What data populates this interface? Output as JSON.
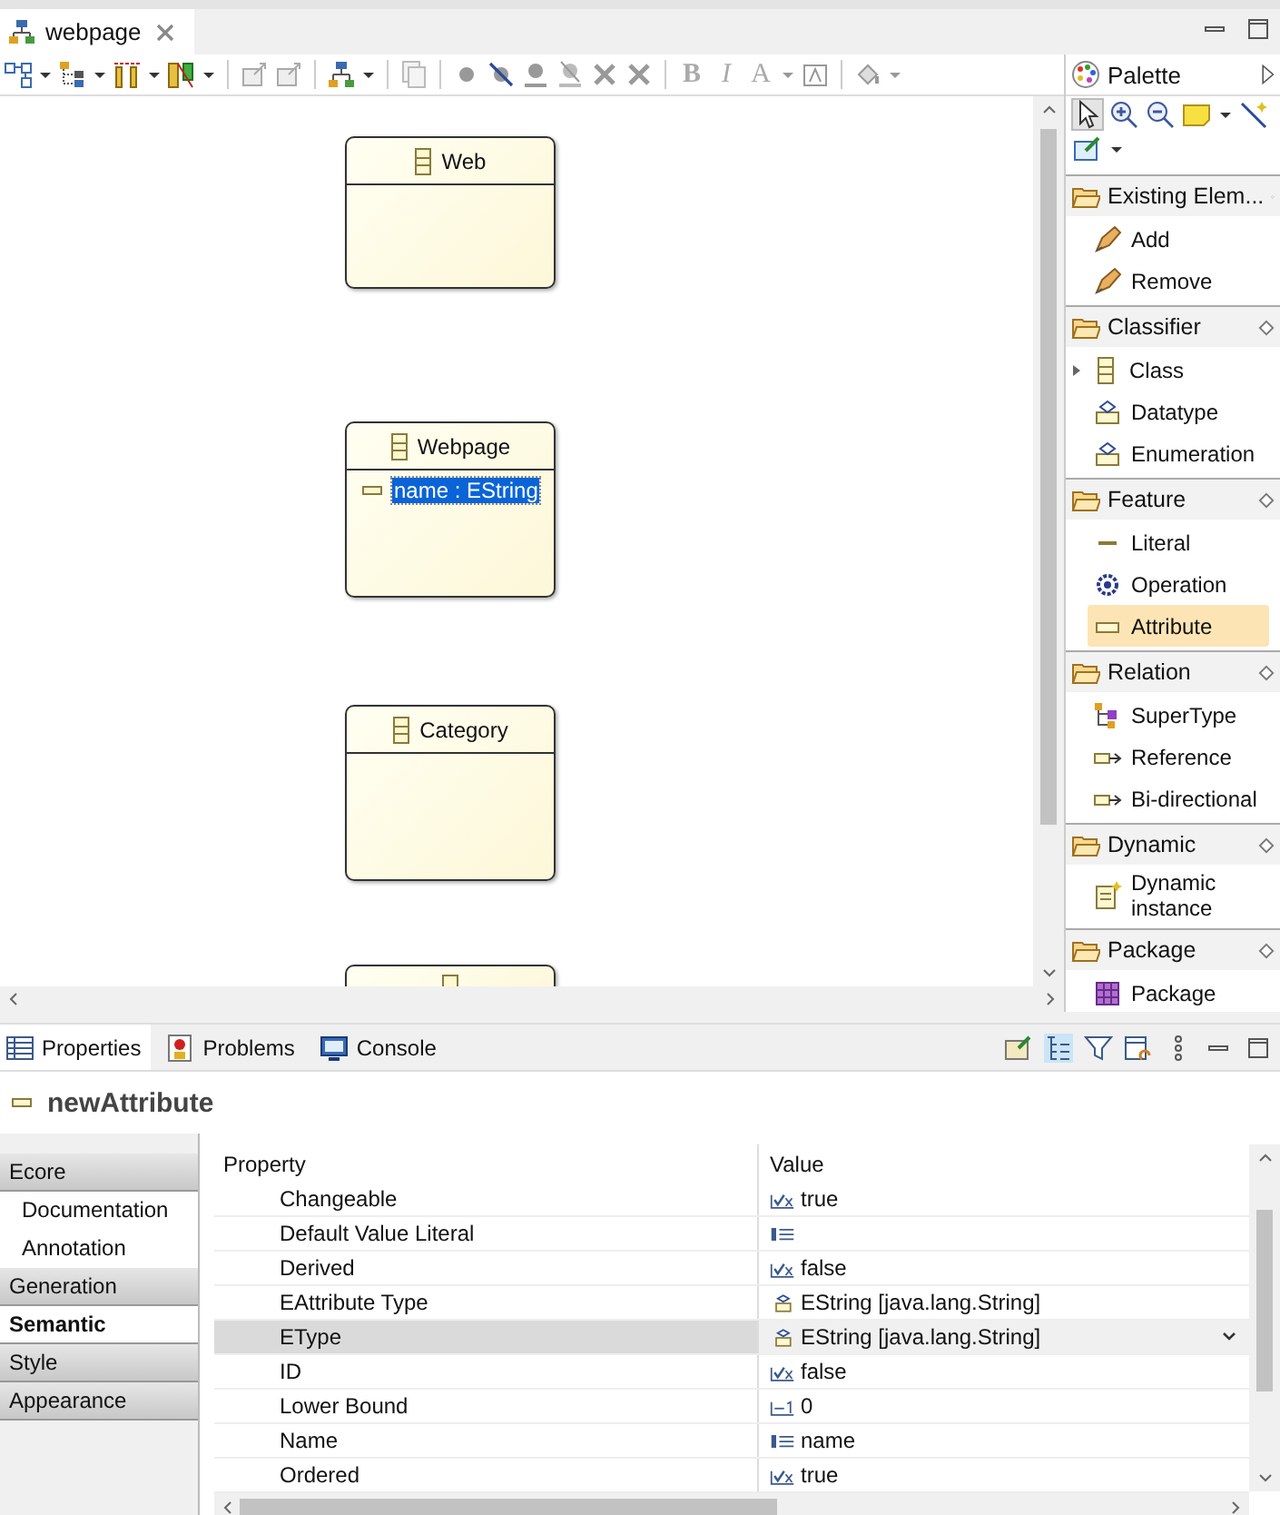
{
  "editor_tab": {
    "title": "webpage"
  },
  "toolbar": {
    "format_buttons": [
      {
        "label": "B",
        "kind": "bold"
      },
      {
        "label": "I",
        "kind": "italic"
      },
      {
        "label": "A",
        "kind": "font"
      }
    ]
  },
  "diagram": {
    "classes": [
      {
        "name": "Web"
      },
      {
        "name": "Webpage",
        "attributes": [
          {
            "label": "name : EString",
            "selected": true
          }
        ]
      },
      {
        "name": "Category"
      }
    ]
  },
  "palette": {
    "title": "Palette",
    "sections": [
      {
        "title": "Existing Elem...",
        "items": [
          {
            "label": "Add",
            "kind": "add",
            "selected": false
          },
          {
            "label": "Remove",
            "kind": "remove",
            "selected": false
          }
        ]
      },
      {
        "title": "Classifier",
        "items": [
          {
            "label": "Class",
            "kind": "class",
            "selected": false
          },
          {
            "label": "Datatype",
            "kind": "datatype",
            "selected": false
          },
          {
            "label": "Enumeration",
            "kind": "enumeration",
            "selected": false
          }
        ]
      },
      {
        "title": "Feature",
        "items": [
          {
            "label": "Literal",
            "kind": "literal",
            "selected": false
          },
          {
            "label": "Operation",
            "kind": "operation",
            "selected": false
          },
          {
            "label": "Attribute",
            "kind": "attribute",
            "selected": true
          }
        ]
      },
      {
        "title": "Relation",
        "items": [
          {
            "label": "SuperType",
            "kind": "supertype",
            "selected": false
          },
          {
            "label": "Reference",
            "kind": "reference",
            "selected": false
          },
          {
            "label": "Bi-directional",
            "kind": "reference",
            "selected": false
          }
        ]
      },
      {
        "title": "Dynamic",
        "items": [
          {
            "label": "Dynamic instance",
            "kind": "dynamic",
            "selected": false
          }
        ]
      },
      {
        "title": "Package",
        "items": [
          {
            "label": "Package",
            "kind": "package",
            "selected": false
          }
        ]
      }
    ]
  },
  "views": {
    "tabs": [
      {
        "label": "Properties",
        "kind": "properties",
        "selected": true
      },
      {
        "label": "Problems",
        "kind": "problems",
        "selected": false
      },
      {
        "label": "Console",
        "kind": "console",
        "selected": false
      }
    ]
  },
  "properties": {
    "title": "newAttribute",
    "categories": [
      {
        "label": "Ecore",
        "kind": "group",
        "selected": false
      },
      {
        "label": "Documentation",
        "kind": "sub",
        "selected": false
      },
      {
        "label": "Annotation",
        "kind": "sub",
        "selected": false
      },
      {
        "label": "Generation",
        "kind": "group",
        "selected": false
      },
      {
        "label": "Semantic",
        "kind": "group",
        "selected": true
      },
      {
        "label": "Style",
        "kind": "group",
        "selected": false
      },
      {
        "label": "Appearance",
        "kind": "group",
        "selected": false
      }
    ],
    "columns": [
      "Property",
      "Value"
    ],
    "rows": [
      {
        "property": "Changeable",
        "value": "true",
        "kind": "boolean",
        "selected": false
      },
      {
        "property": "Default Value Literal",
        "kind": "text",
        "selected": false
      },
      {
        "property": "Derived",
        "value": "false",
        "kind": "boolean",
        "selected": false
      },
      {
        "property": "EAttribute Type",
        "value": "EString [java.lang.String]",
        "kind": "type",
        "selected": false
      },
      {
        "property": "EType",
        "value": "EString [java.lang.String]",
        "kind": "type",
        "selected": true
      },
      {
        "property": "ID",
        "value": "false",
        "kind": "boolean",
        "selected": false
      },
      {
        "property": "Lower Bound",
        "value": "0",
        "kind": "number",
        "selected": false
      },
      {
        "property": "Name",
        "value": "name",
        "kind": "text",
        "selected": false
      },
      {
        "property": "Ordered",
        "value": "true",
        "kind": "boolean",
        "selected": false
      }
    ]
  }
}
